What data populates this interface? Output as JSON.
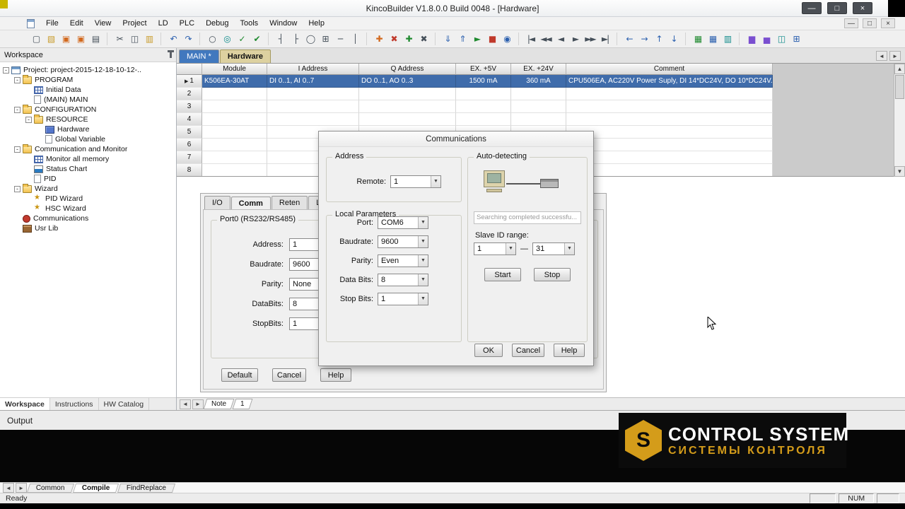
{
  "window": {
    "title": "KincoBuilder V1.8.0.0 Build 0048 - [Hardware]",
    "controls": {
      "minimize": "—",
      "maximize": "□",
      "close": "×"
    }
  },
  "menu": {
    "items": [
      "File",
      "Edit",
      "View",
      "Project",
      "LD",
      "PLC",
      "Debug",
      "Tools",
      "Window",
      "Help"
    ]
  },
  "nav": {
    "left": "◄",
    "right": "►",
    "up": "▲",
    "down": "▼"
  },
  "toolbar": {
    "icons": [
      {
        "name": "new-file-icon",
        "glyph": "▢"
      },
      {
        "name": "open-project-icon",
        "glyph": "▧"
      },
      {
        "name": "save-icon",
        "glyph": "▣"
      },
      {
        "name": "save-all-icon",
        "glyph": "▣"
      },
      {
        "name": "print-icon",
        "glyph": "▤"
      },
      {
        "name": "cut-icon",
        "glyph": "✂"
      },
      {
        "name": "copy-icon",
        "glyph": "◫"
      },
      {
        "name": "paste-icon",
        "glyph": "▥"
      },
      {
        "name": "undo-icon",
        "glyph": "↶"
      },
      {
        "name": "redo-icon",
        "glyph": "↷"
      },
      {
        "name": "find-icon",
        "glyph": "○"
      },
      {
        "name": "replace-icon",
        "glyph": "◎"
      },
      {
        "name": "check-icon",
        "glyph": "✓"
      },
      {
        "name": "build-icon",
        "glyph": "✔"
      },
      {
        "name": "ladder-contact-icon",
        "glyph": "┤"
      },
      {
        "name": "ladder-contact-closed-icon",
        "glyph": "├"
      },
      {
        "name": "ladder-coil-icon",
        "glyph": "◯"
      },
      {
        "name": "ladder-block-icon",
        "glyph": "⊞"
      },
      {
        "name": "ladder-hline-icon",
        "glyph": "─"
      },
      {
        "name": "ladder-vline-icon",
        "glyph": "│"
      },
      {
        "name": "insert-network-icon",
        "glyph": "✚"
      },
      {
        "name": "delete-network-icon",
        "glyph": "✖"
      },
      {
        "name": "insert-row-icon",
        "glyph": "✚"
      },
      {
        "name": "delete-row-icon",
        "glyph": "✖"
      },
      {
        "name": "download-icon",
        "glyph": "⇓"
      },
      {
        "name": "upload-icon",
        "glyph": "⇑"
      },
      {
        "name": "run-icon",
        "glyph": "►"
      },
      {
        "name": "stop-icon",
        "glyph": "■"
      },
      {
        "name": "monitor-icon",
        "glyph": "◉"
      },
      {
        "name": "nav-first-icon",
        "glyph": "|◄"
      },
      {
        "name": "nav-prev-fast-icon",
        "glyph": "◄◄"
      },
      {
        "name": "nav-prev-icon",
        "glyph": "◄"
      },
      {
        "name": "nav-next-icon",
        "glyph": "►"
      },
      {
        "name": "nav-next-fast-icon",
        "glyph": "►►"
      },
      {
        "name": "nav-last-icon",
        "glyph": "►|"
      },
      {
        "name": "jump-back-icon",
        "glyph": "←"
      },
      {
        "name": "jump-forward-icon",
        "glyph": "→"
      },
      {
        "name": "move-up-icon",
        "glyph": "↑"
      },
      {
        "name": "move-down-icon",
        "glyph": "↓"
      },
      {
        "name": "grid-view-icon",
        "glyph": "▦"
      },
      {
        "name": "memory-view-icon",
        "glyph": "▦"
      },
      {
        "name": "table-view-icon",
        "glyph": "▥"
      },
      {
        "name": "chart-columns-icon",
        "glyph": "▆"
      },
      {
        "name": "status-chart-icon",
        "glyph": "▅"
      },
      {
        "name": "cascade-windows-icon",
        "glyph": "◫"
      },
      {
        "name": "tile-windows-icon",
        "glyph": "⊞"
      }
    ]
  },
  "workspace": {
    "title": "Workspace",
    "collapse_glyph": "-",
    "tree": [
      {
        "label": "Project: project-2015-12-18-10-12-.."
      },
      {
        "label": "PROGRAM"
      },
      {
        "label": "Initial Data"
      },
      {
        "label": "(MAIN) MAIN"
      },
      {
        "label": "CONFIGURATION"
      },
      {
        "label": "RESOURCE"
      },
      {
        "label": "Hardware"
      },
      {
        "label": "Global Variable"
      },
      {
        "label": "Communication and Monitor"
      },
      {
        "label": "Monitor all memory"
      },
      {
        "label": "Status Chart"
      },
      {
        "label": "PID"
      },
      {
        "label": "Wizard"
      },
      {
        "label": "PID Wizard"
      },
      {
        "label": "HSC Wizard"
      },
      {
        "label": "Communications"
      },
      {
        "label": "Usr Lib"
      }
    ],
    "tabs": [
      "Workspace",
      "Instructions",
      "HW Catalog"
    ]
  },
  "document_tabs": {
    "main": "MAIN *",
    "hardware": "Hardware"
  },
  "hardware_table": {
    "columns": [
      "Module",
      "I Address",
      "Q Address",
      "EX. +5V",
      "EX. +24V",
      "Comment"
    ],
    "row_numbers": [
      "1",
      "2",
      "3",
      "4",
      "5",
      "6",
      "7",
      "8"
    ],
    "row_marker": "▶",
    "row1": {
      "module": "K506EA-30AT",
      "i_address": "DI 0..1, AI 0..7",
      "q_address": "DO 0..1, AO 0..3",
      "ex_5v": "1500 mA",
      "ex_24v": "360 mA",
      "comment": "CPU506EA, AC220V Power Suply, DI 14*DC24V, DO 10*DC24V."
    }
  },
  "config_sheet": {
    "tabs": [
      "I/O",
      "Comm",
      "Reten",
      "Local"
    ],
    "group_title": "Port0 (RS232/RS485)",
    "fields": [
      {
        "label": "Address:",
        "value": "1"
      },
      {
        "label": "Baudrate:",
        "value": "9600"
      },
      {
        "label": "Parity:",
        "value": "None"
      },
      {
        "label": "DataBits:",
        "value": "8"
      },
      {
        "label": "StopBits:",
        "value": "1"
      }
    ],
    "buttons": {
      "default": "Default",
      "cancel": "Cancel",
      "help": "Help"
    }
  },
  "comm_dialog": {
    "title": "Communications",
    "address_group": {
      "title": "Address",
      "remote_label": "Remote:",
      "remote_value": "1"
    },
    "local_group": {
      "title": "Local Parameters",
      "fields": [
        {
          "label": "Port:",
          "value": "COM6"
        },
        {
          "label": "Baudrate:",
          "value": "9600"
        },
        {
          "label": "Parity:",
          "value": "Even"
        },
        {
          "label": "Data Bits:",
          "value": "8"
        },
        {
          "label": "Stop Bits:",
          "value": "1"
        }
      ]
    },
    "auto_group": {
      "title": "Auto-detecting",
      "status_text": "Searching completed successfu...",
      "slave_label": "Slave ID range:",
      "from_value": "1",
      "range_dash": "—",
      "to_value": "31",
      "start_label": "Start",
      "stop_label": "Stop"
    },
    "buttons": {
      "ok": "OK",
      "cancel": "Cancel",
      "help": "Help"
    }
  },
  "note_bar": {
    "tabs": [
      "Note",
      "1"
    ]
  },
  "output": {
    "title": "Output",
    "tabs": [
      "Common",
      "Compile",
      "FindReplace"
    ]
  },
  "statusbar": {
    "ready": "Ready",
    "num": "NUM"
  },
  "watermark": {
    "logo_letter": "S",
    "line1": "CONTROL SYSTEM",
    "line2": "СИСТЕМЫ КОНТРОЛЯ"
  },
  "colors": {
    "selection_blue": "#3f6cab",
    "active_tab_tan": "#ddd1a0",
    "accent_gold": "#d49c1a"
  }
}
